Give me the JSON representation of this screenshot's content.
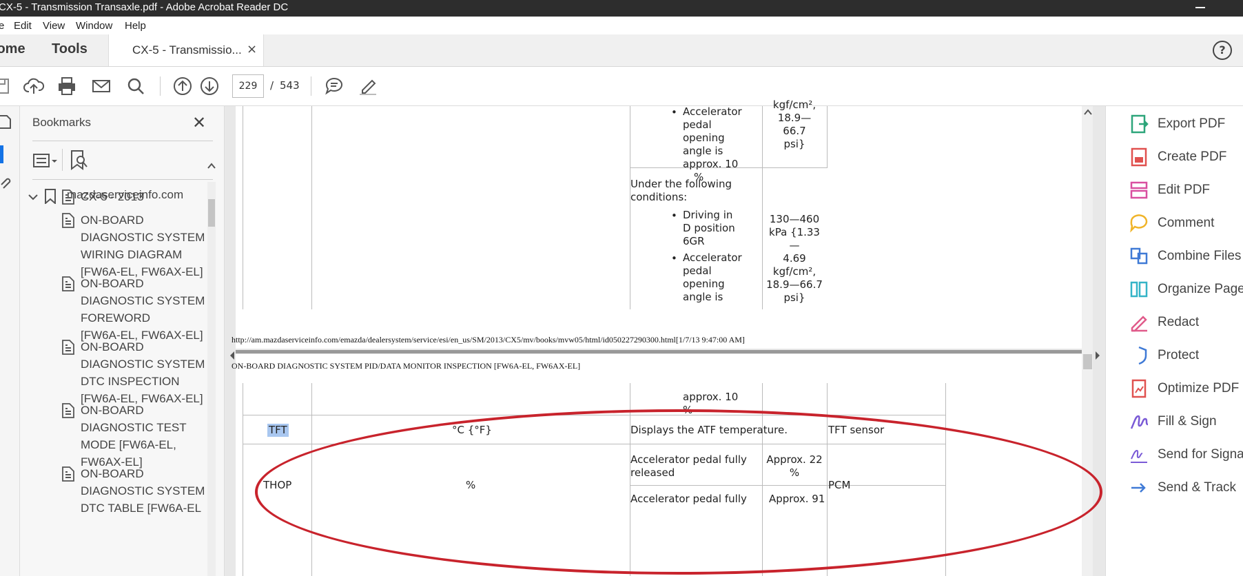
{
  "window": {
    "title": "CX-5 - Transmission Transaxle.pdf - Adobe Acrobat Reader DC"
  },
  "menu": [
    "e",
    "Edit",
    "View",
    "Window",
    "Help"
  ],
  "nav_tabs": {
    "home": "Home",
    "tools": "Tools"
  },
  "doc_tab": {
    "label": "CX-5 - Transmissio...",
    "close": "×"
  },
  "help_label": "?",
  "toolbar": {
    "page_current": "229",
    "page_sep": "/",
    "page_total": "543"
  },
  "bookmarks": {
    "title": "Bookmarks",
    "close": "✕",
    "root": "mazdaserviceinfo.com",
    "items": [
      [
        "CX-5 - 2013"
      ],
      [
        "ON-BOARD",
        "DIAGNOSTIC SYSTEM",
        "WIRING DIAGRAM",
        "[FW6A-EL, FW6AX-EL]"
      ],
      [
        "ON-BOARD",
        "DIAGNOSTIC SYSTEM",
        "FOREWORD",
        "[FW6A-EL, FW6AX-EL]"
      ],
      [
        "ON-BOARD",
        "DIAGNOSTIC SYSTEM",
        "DTC INSPECTION",
        "[FW6A-EL, FW6AX-EL]"
      ],
      [
        "ON-BOARD",
        "DIAGNOSTIC TEST",
        "MODE [FW6A-EL,",
        "FW6AX-EL]"
      ],
      [
        "ON-BOARD",
        "DIAGNOSTIC SYSTEM",
        "DTC TABLE [FW6A-EL"
      ]
    ]
  },
  "document": {
    "page1": {
      "bullets_a": [
        "Accelerator",
        "pedal",
        "opening",
        "angle is",
        "approx. 10",
        "%"
      ],
      "value_a": [
        "kgf/cm²,",
        "18.9—66.7",
        "psi}"
      ],
      "condition_intro": [
        "Under the following",
        "conditions:"
      ],
      "bullet_b1": [
        "Driving in",
        "D position",
        "6GR"
      ],
      "bullet_b2": [
        "Accelerator",
        "pedal",
        "opening",
        "angle is"
      ],
      "value_b": [
        "130—460",
        "kPa {1.33—",
        "4.69",
        "kgf/cm²,",
        "18.9—66.7",
        "psi}"
      ],
      "footer_url": "http://am.mazdaserviceinfo.com/emazda/dealersystem/service/esi/en_us/SM/2013/CX5/mv/books/mvw05/html/id050227290300.html[1/7/13 9:47:00 AM]"
    },
    "page2": {
      "header": "ON-BOARD DIAGNOSTIC SYSTEM PID/DATA MONITOR INSPECTION [FW6A-EL, FW6AX-EL]",
      "cont_a": [
        "approx. 10",
        "%"
      ],
      "row_tft": {
        "pid": "TFT",
        "unit": "°C {°F}",
        "desc": "Displays the ATF temperature.",
        "source": "TFT sensor"
      },
      "row_thop": {
        "pid": "THOP",
        "unit": "%",
        "cond1": [
          "Accelerator pedal fully",
          "released"
        ],
        "val1": [
          "Approx. 22",
          "%"
        ],
        "cond2": "Accelerator pedal fully",
        "val2": "Approx. 91",
        "source": "PCM"
      }
    }
  },
  "tools": [
    {
      "label": "Export PDF",
      "color": "#2da57a"
    },
    {
      "label": "Create PDF",
      "color": "#e0514f"
    },
    {
      "label": "Edit PDF",
      "color": "#d94fa0"
    },
    {
      "label": "Comment",
      "color": "#f0b429"
    },
    {
      "label": "Combine Files",
      "color": "#3f7ad6"
    },
    {
      "label": "Organize Pages",
      "color": "#34b4c7"
    },
    {
      "label": "Redact",
      "color": "#e05a8a"
    },
    {
      "label": "Protect",
      "color": "#3f7ad6"
    },
    {
      "label": "Optimize PDF",
      "color": "#e0514f"
    },
    {
      "label": "Fill & Sign",
      "color": "#7a5ad6"
    },
    {
      "label": "Send for Signature",
      "color": "#7a5ad6"
    },
    {
      "label": "Send & Track",
      "color": "#3f7ad6"
    }
  ],
  "annotation_color": "#c8232c"
}
